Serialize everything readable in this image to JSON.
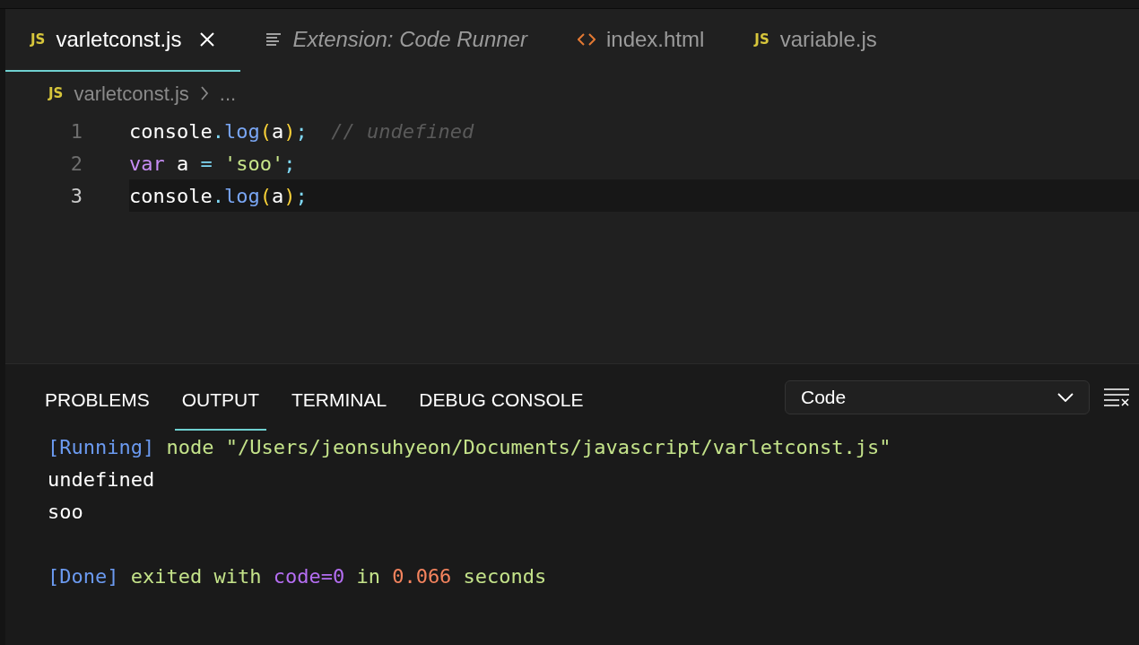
{
  "tabs": [
    {
      "kind": "js",
      "badge": "JS",
      "label": "varletconst.js",
      "selected": true,
      "preview": false,
      "closable": true
    },
    {
      "kind": "lines",
      "label": "Extension: Code Runner",
      "selected": false,
      "preview": true,
      "closable": false
    },
    {
      "kind": "html",
      "label": "index.html",
      "selected": false,
      "preview": false,
      "closable": false
    },
    {
      "kind": "js",
      "badge": "JS",
      "label": "variable.js",
      "selected": false,
      "preview": false,
      "closable": false
    }
  ],
  "breadcrumb": {
    "kind": "js",
    "badge": "JS",
    "file": "varletconst.js",
    "rest": "..."
  },
  "code_lines": [
    {
      "number": "1",
      "current": false,
      "tokens": [
        {
          "kind": "plain",
          "text": "console"
        },
        {
          "kind": "punct",
          "text": "."
        },
        {
          "kind": "func",
          "text": "log"
        },
        {
          "kind": "paren",
          "text": "("
        },
        {
          "kind": "plain",
          "text": "a"
        },
        {
          "kind": "paren",
          "text": ")"
        },
        {
          "kind": "punct",
          "text": ";"
        },
        {
          "kind": "comment",
          "text": "  // undefined"
        }
      ]
    },
    {
      "number": "2",
      "current": false,
      "tokens": [
        {
          "kind": "keyword",
          "text": "var"
        },
        {
          "kind": "plain",
          "text": " a "
        },
        {
          "kind": "punct",
          "text": "= "
        },
        {
          "kind": "string",
          "text": "'soo'"
        },
        {
          "kind": "punct",
          "text": ";"
        }
      ]
    },
    {
      "number": "3",
      "current": true,
      "tokens": [
        {
          "kind": "plain",
          "text": "console"
        },
        {
          "kind": "punct",
          "text": "."
        },
        {
          "kind": "func",
          "text": "log"
        },
        {
          "kind": "paren",
          "text": "("
        },
        {
          "kind": "plain",
          "text": "a"
        },
        {
          "kind": "paren",
          "text": ")"
        },
        {
          "kind": "punct",
          "text": ";"
        }
      ]
    }
  ],
  "panel_tabs": [
    {
      "label": "PROBLEMS",
      "selected": false
    },
    {
      "label": "OUTPUT",
      "selected": true
    },
    {
      "label": "TERMINAL",
      "selected": false
    },
    {
      "label": "DEBUG CONSOLE",
      "selected": false
    }
  ],
  "output_channel": {
    "value": "Code"
  },
  "output_lines": [
    [
      {
        "kind": "tag",
        "text": "[Running]"
      },
      {
        "kind": "green",
        "text": " node \"/Users/jeonsuhyeon/Documents/javascript/varletconst.js\""
      }
    ],
    [
      {
        "kind": "plain",
        "text": "undefined"
      }
    ],
    [
      {
        "kind": "plain",
        "text": "soo"
      }
    ],
    [
      {
        "kind": "gap"
      },
      {
        "kind": "tag",
        "text": "[Done]"
      },
      {
        "kind": "green",
        "text": " exited with "
      },
      {
        "kind": "purple",
        "text": "code=0"
      },
      {
        "kind": "green",
        "text": " in "
      },
      {
        "kind": "orange",
        "text": "0.066"
      },
      {
        "kind": "green",
        "text": " seconds"
      }
    ]
  ]
}
